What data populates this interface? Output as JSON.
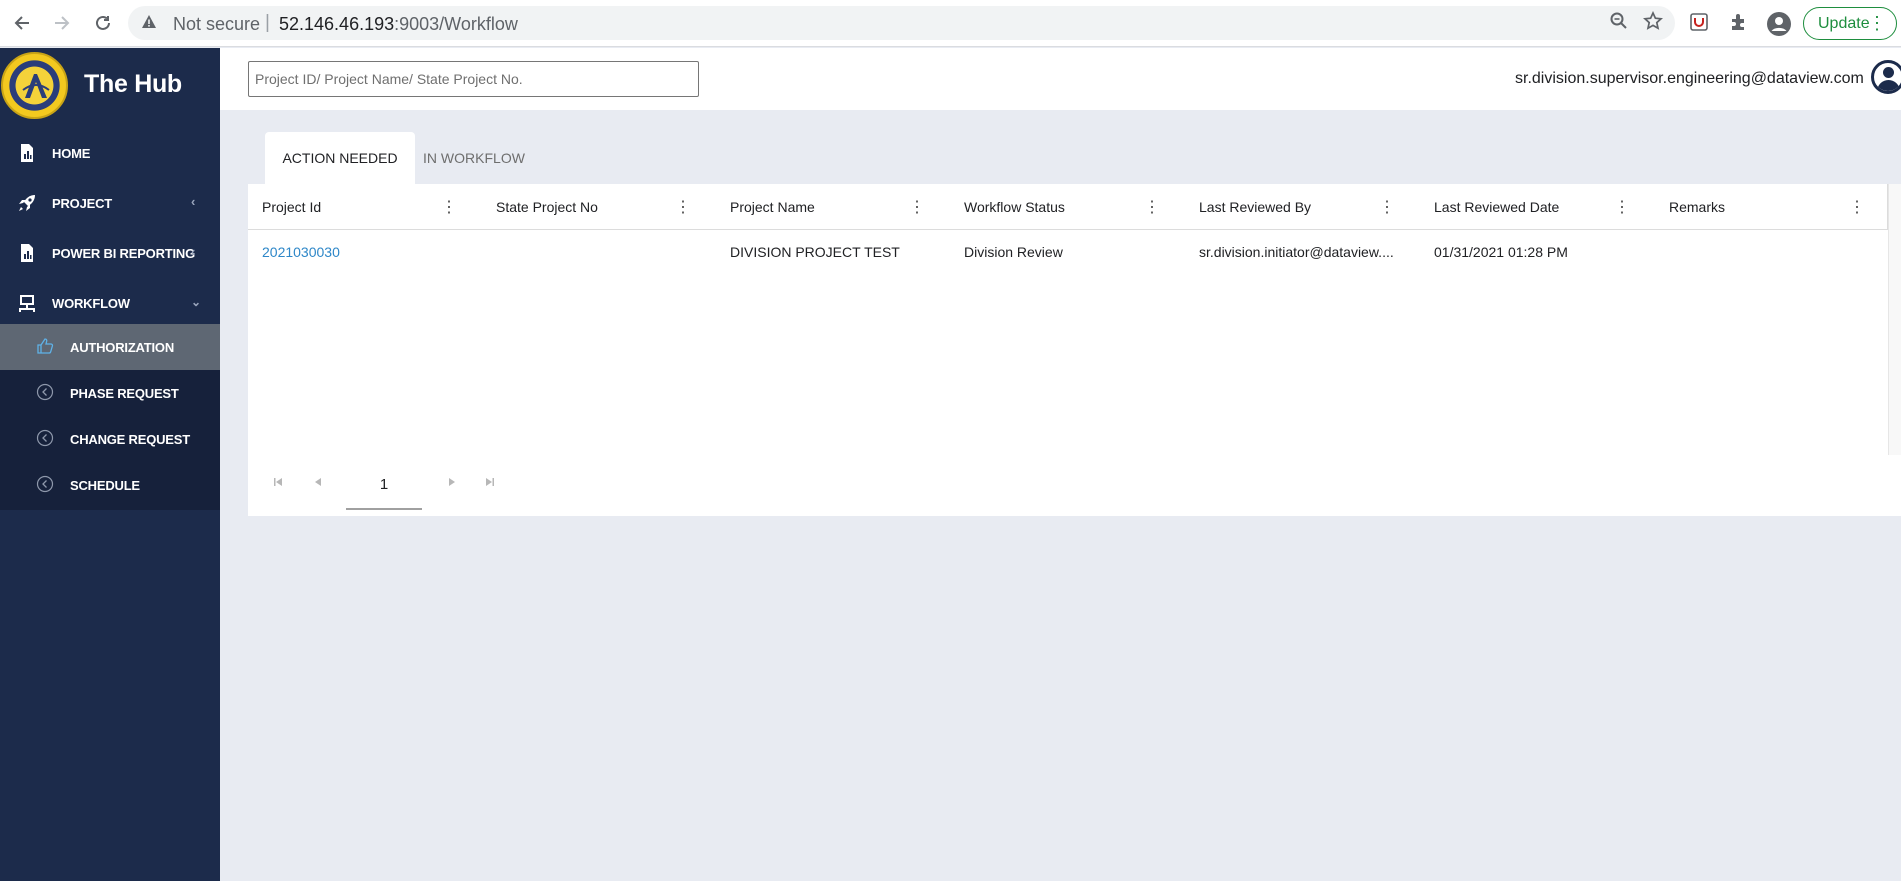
{
  "browser": {
    "security_label": "Not secure",
    "url_host": "52.146.46.193",
    "url_rest": ":9003/Workflow",
    "update_label": "Update"
  },
  "brand": {
    "title": "The Hub"
  },
  "sidebar": {
    "items": [
      {
        "label": "HOME",
        "icon": "report-icon"
      },
      {
        "label": "PROJECT",
        "icon": "rocket-icon"
      },
      {
        "label": "POWER BI REPORTING",
        "icon": "chart-icon"
      },
      {
        "label": "WORKFLOW",
        "icon": "workflow-icon"
      }
    ],
    "workflow_submenu": [
      {
        "label": "AUTHORIZATION",
        "icon": "thumbs-up-icon",
        "active": true
      },
      {
        "label": "PHASE REQUEST",
        "icon": "circle-arrow-left-icon"
      },
      {
        "label": "CHANGE REQUEST",
        "icon": "circle-arrow-left-icon"
      },
      {
        "label": "SCHEDULE",
        "icon": "circle-arrow-left-icon"
      }
    ]
  },
  "header": {
    "search_placeholder": "Project ID/ Project Name/ State Project No.",
    "user_email": "sr.division.supervisor.engineering@dataview.com"
  },
  "tabs": [
    {
      "label": "ACTION NEEDED",
      "active": true
    },
    {
      "label": "IN WORKFLOW",
      "active": false
    }
  ],
  "grid": {
    "columns": [
      "Project Id",
      "State Project No",
      "Project Name",
      "Workflow Status",
      "Last Reviewed By",
      "Last Reviewed Date",
      "Remarks"
    ],
    "rows": [
      {
        "project_id": "2021030030",
        "state_project_no": "",
        "project_name": "DIVISION PROJECT TEST",
        "workflow_status": "Division Review",
        "last_reviewed_by": "sr.division.initiator@dataview....",
        "last_reviewed_date": "01/31/2021 01:28 PM",
        "remarks": ""
      }
    ]
  },
  "pager": {
    "current_page": "1"
  },
  "colors": {
    "sidebar_bg": "#1c2b4b",
    "active_submenu_bg": "#5e6773",
    "link": "#2e87c8",
    "page_bg": "#e8ebf2"
  }
}
